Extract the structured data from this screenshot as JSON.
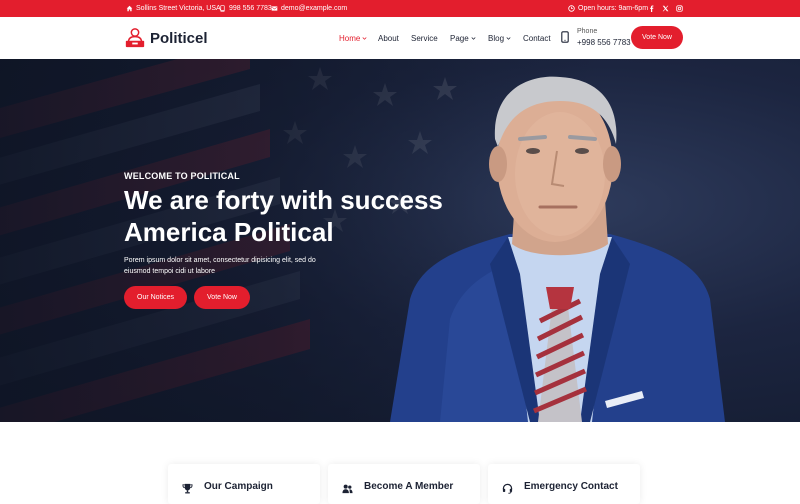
{
  "topbar": {
    "address": "Sollins Street Victoria, USA",
    "phone": "998 556 7783",
    "email": "demo@example.com",
    "hours": "Open hours: 9am-6pm",
    "social_icons": [
      "facebook-icon",
      "x-icon",
      "instagram-icon"
    ]
  },
  "header": {
    "logo_text": "Politicel",
    "nav": [
      {
        "label": "Home",
        "has_dropdown": true,
        "active": true
      },
      {
        "label": "About",
        "has_dropdown": false
      },
      {
        "label": "Service",
        "has_dropdown": false
      },
      {
        "label": "Page",
        "has_dropdown": true
      },
      {
        "label": "Blog",
        "has_dropdown": true
      },
      {
        "label": "Contact",
        "has_dropdown": false
      }
    ],
    "phone_label": "Phone",
    "phone_number": "+998 556 7783",
    "vote_button": "Vote Now"
  },
  "hero": {
    "eyebrow": "WELCOME TO POLITICAL",
    "title_line1": "We are forty with success",
    "title_line2": "America Political",
    "description_line1": "Porem ipsum dolor sit amet, consectetur dipisicing elit, sed do",
    "description_line2": "eiusmod tempoi cidi ut labore",
    "primary_button": "Our Notices",
    "secondary_button": "Vote Now"
  },
  "cards": [
    {
      "icon": "trophy-icon",
      "title": "Our Campaign"
    },
    {
      "icon": "users-icon",
      "title": "Become A Member"
    },
    {
      "icon": "headset-icon",
      "title": "Emergency Contact"
    }
  ],
  "colors": {
    "accent": "#e31e2d",
    "dark_text": "#1c2233",
    "hero_bg": "#1c2540"
  }
}
